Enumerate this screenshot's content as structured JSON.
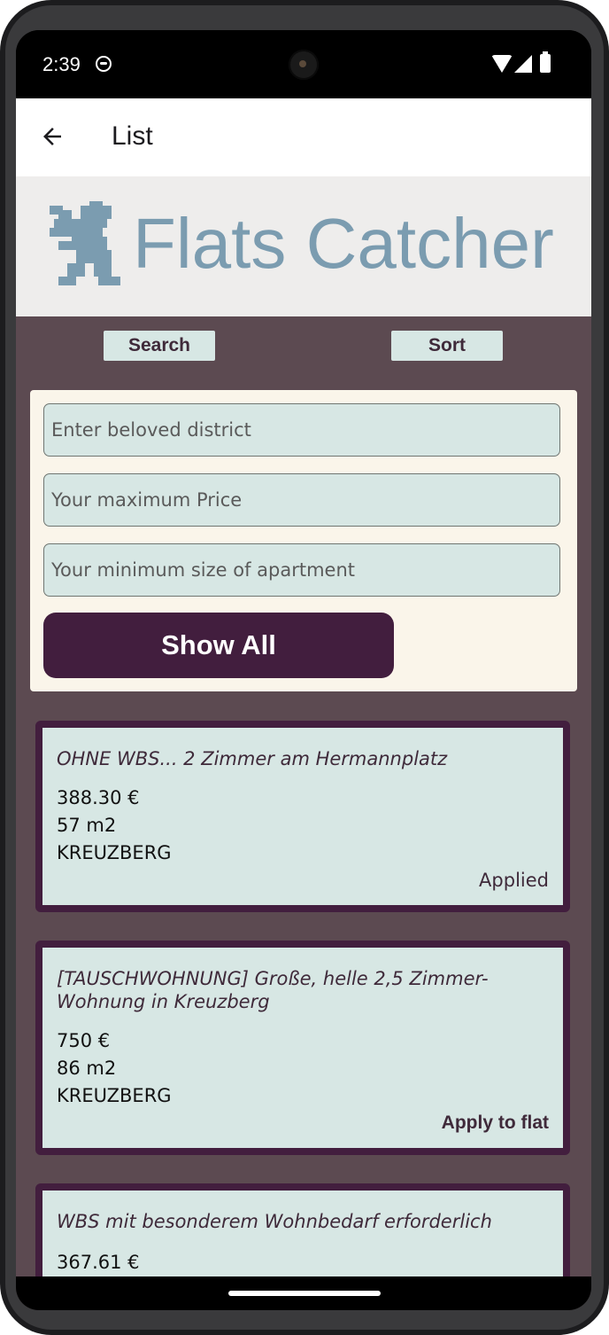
{
  "status_bar": {
    "time": "2:39"
  },
  "app_bar": {
    "title": "List"
  },
  "header": {
    "logo_text": "Flats Catcher"
  },
  "tabs": {
    "search_label": "Search",
    "sort_label": "Sort"
  },
  "filters": {
    "district_placeholder": "Enter beloved district",
    "price_placeholder": "Your maximum Price",
    "size_placeholder": "Your minimum size of apartment",
    "show_all_label": "Show All"
  },
  "flats": [
    {
      "title": "OHNE WBS... 2 Zimmer am Hermannplatz",
      "price": "388.30 €",
      "size": "57 m2",
      "district": "KREUZBERG",
      "status": "Applied"
    },
    {
      "title": "[TAUSCHWOHNUNG] Große, helle 2,5  Zimmer-Wohnung in Kreuzberg",
      "price": "750 €",
      "size": "86 m2",
      "district": "KREUZBERG",
      "status": "Apply to flat"
    },
    {
      "title": "WBS mit besonderem Wohnbedarf erforderlich",
      "price": "367.61 €"
    }
  ],
  "colors": {
    "primary": "#421e3e",
    "background": "#5c4a51",
    "card": "#d7e7e4",
    "logo": "#7b9cb0",
    "filter_panel": "#faf5ea"
  }
}
